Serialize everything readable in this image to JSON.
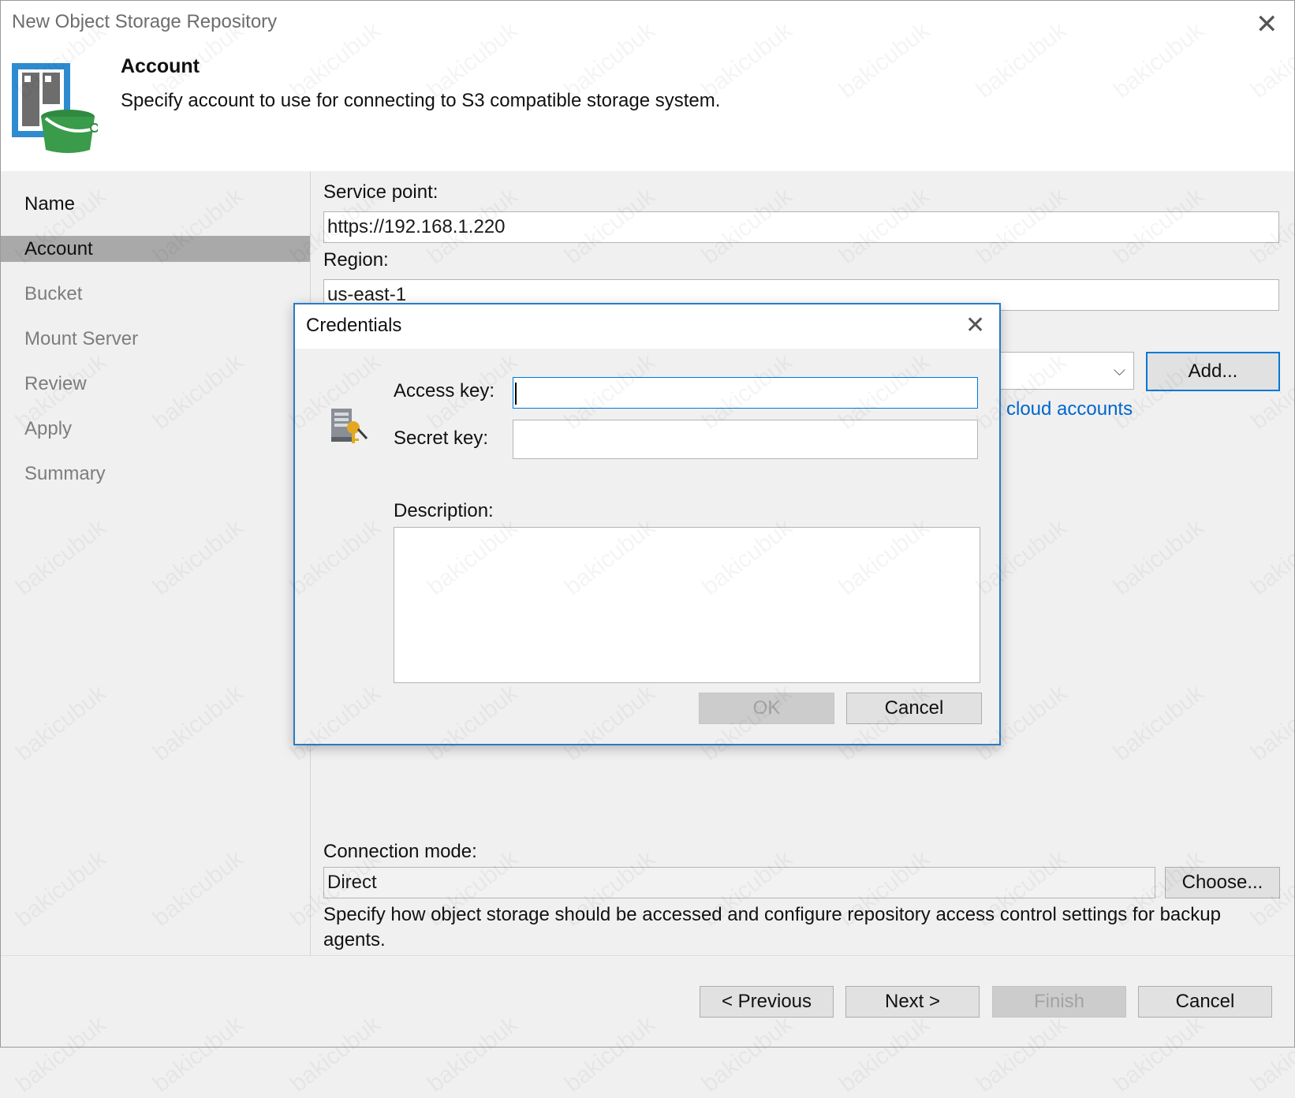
{
  "window": {
    "title": "New Object Storage Repository",
    "close_glyph": "✕"
  },
  "header": {
    "step_title": "Account",
    "step_description": "Specify account to use for connecting to S3 compatible storage system.",
    "icon": "object-storage-bucket-icon"
  },
  "nav": {
    "items": [
      {
        "label": "Name",
        "state": "done"
      },
      {
        "label": "Account",
        "state": "active"
      },
      {
        "label": "Bucket",
        "state": "pending"
      },
      {
        "label": "Mount Server",
        "state": "pending"
      },
      {
        "label": "Review",
        "state": "pending"
      },
      {
        "label": "Apply",
        "state": "pending"
      },
      {
        "label": "Summary",
        "state": "pending"
      }
    ]
  },
  "form": {
    "service_point_label": "Service point:",
    "service_point_value": "https://192.168.1.220",
    "region_label": "Region:",
    "region_value": "us-east-1",
    "credentials_value": "",
    "add_button": "Add...",
    "manage_link_visible": "cloud accounts",
    "connection_mode_label": "Connection mode:",
    "connection_mode_value": "Direct",
    "choose_button": "Choose...",
    "connection_mode_help": "Specify how object storage should be accessed and configure repository access control settings for backup agents."
  },
  "footer": {
    "previous": "< Previous",
    "next": "Next >",
    "finish": "Finish",
    "cancel": "Cancel"
  },
  "dialog": {
    "title": "Credentials",
    "close_glyph": "✕",
    "icon": "credentials-key-icon",
    "access_key_label": "Access key:",
    "access_key_value": "",
    "secret_key_label": "Secret key:",
    "secret_key_value": "",
    "description_label": "Description:",
    "description_value": "",
    "ok": "OK",
    "cancel": "Cancel"
  },
  "watermark": "bakicubuk",
  "colors": {
    "accent": "#0078d7",
    "dialog_border": "#2a7bc4",
    "nav_active": "#a9a9a9",
    "link": "#0066cc",
    "bucket_green": "#3a9b4a",
    "panel_blue": "#2e8bd0"
  }
}
